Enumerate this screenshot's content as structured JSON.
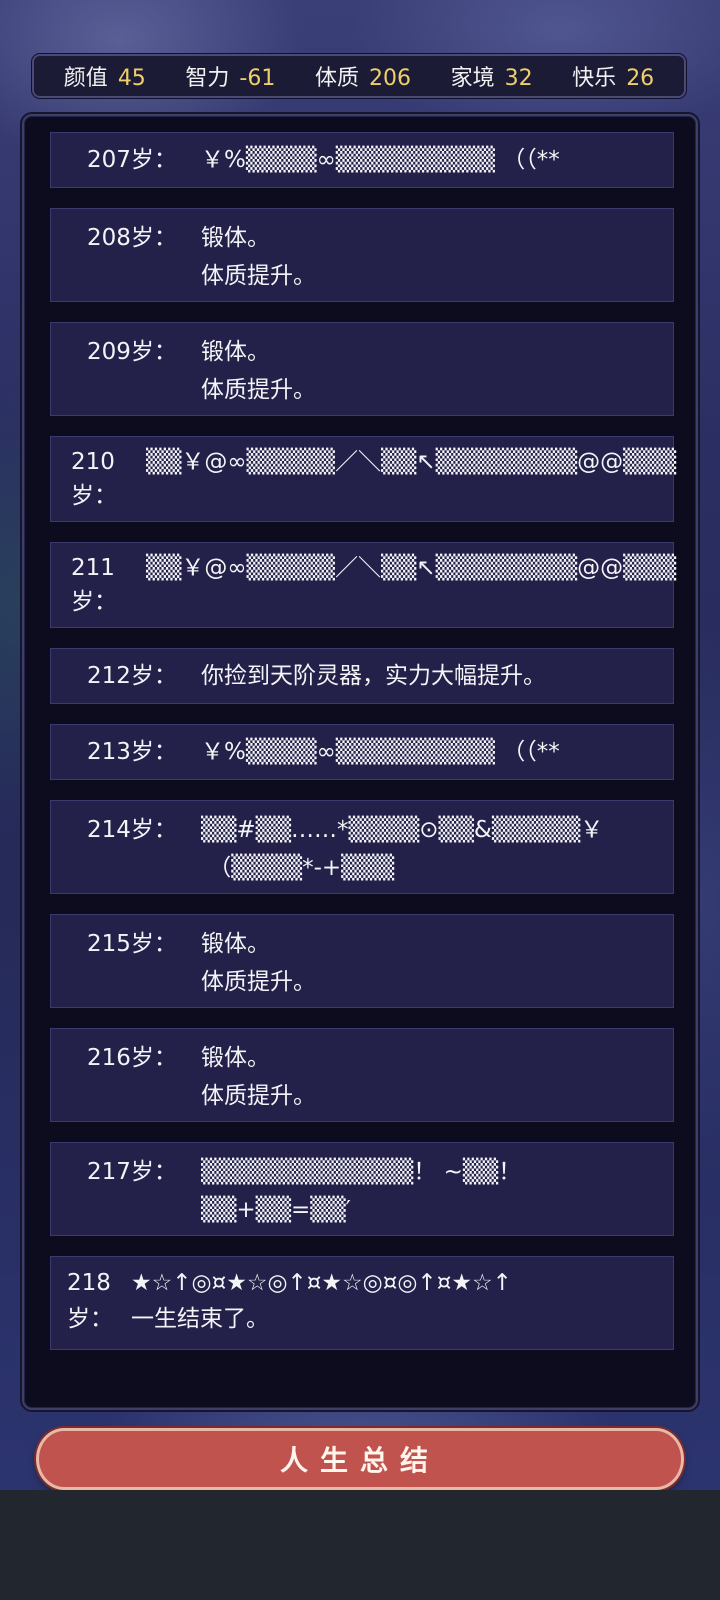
{
  "stats": [
    {
      "label": "颜值",
      "value": "45"
    },
    {
      "label": "智力",
      "value": "-61"
    },
    {
      "label": "体质",
      "value": "206"
    },
    {
      "label": "家境",
      "value": "32"
    },
    {
      "label": "快乐",
      "value": "26"
    }
  ],
  "log": [
    {
      "age": "207岁：",
      "text": "￥%▒▒▒▒∞▒▒▒▒▒▒▒▒▒ （（**"
    },
    {
      "age": "208岁：",
      "text": "锻体。\n体质提升。"
    },
    {
      "age": "209岁：",
      "text": "锻体。\n体质提升。"
    },
    {
      "age": "210岁：",
      "text": "▒▒￥@∞▒▒▒▒▒／＼▒▒↖▒▒▒▒▒▒▒▒@@▒▒▒"
    },
    {
      "age": "211岁：",
      "text": "▒▒￥@∞▒▒▒▒▒／＼▒▒↖▒▒▒▒▒▒▒▒@@▒▒▒"
    },
    {
      "age": "212岁：",
      "text": "你捡到天阶灵器，实力大幅提升。"
    },
    {
      "age": "213岁：",
      "text": "￥%▒▒▒▒∞▒▒▒▒▒▒▒▒▒ （（**"
    },
    {
      "age": "214岁：",
      "text": "▒▒#▒▒……*▒▒▒▒⊙▒▒&▒▒▒▒▒￥\n （▒▒▒▒*-+▒▒▒"
    },
    {
      "age": "215岁：",
      "text": "锻体。\n体质提升。"
    },
    {
      "age": "216岁：",
      "text": "锻体。\n体质提升。"
    },
    {
      "age": "217岁：",
      "text": "▒▒▒▒▒▒▒▒▒▒▒▒！ ~▒▒！\n▒▒+▒▒=▒▒′"
    },
    {
      "age": "218岁：",
      "text": "★☆↑◎¤★☆◎↑¤★☆◎¤◎↑¤★☆↑\n一生结束了。"
    }
  ],
  "button": {
    "label": "人生总结"
  }
}
